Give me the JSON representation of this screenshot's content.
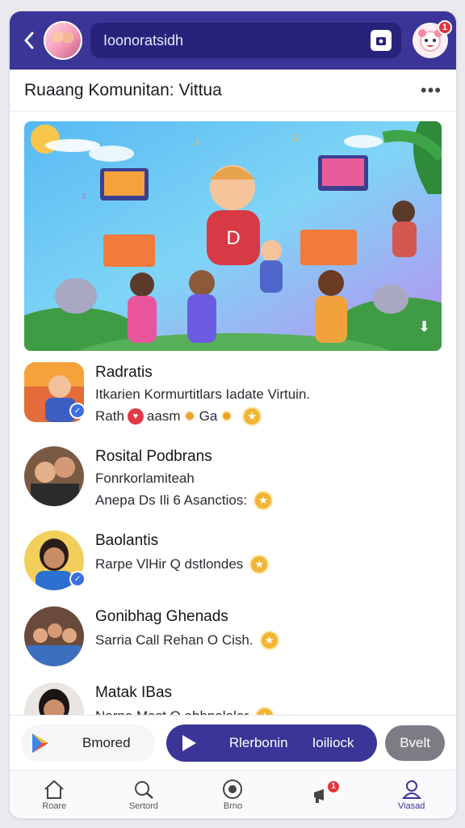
{
  "header": {
    "search_text": "Ioonoratsidh",
    "notification_count": "1"
  },
  "title_row": {
    "title": "Ruaang Komunitan: Vittua"
  },
  "hero": {
    "description_icon": "community-party-illustration"
  },
  "items": [
    {
      "name": "Radratis",
      "line1": "Itkarien Kormurtitlars Iadate Virtuin.",
      "line2": "Rath",
      "line2_b": "aasm",
      "line2_c": "Ga"
    },
    {
      "name": "Rosital Podbrans",
      "line1": "Fonrkorlamiteah",
      "line2": "Anepa Ds Ili 6 Asanctios:"
    },
    {
      "name": "Baolantis",
      "line1": "Rarpe VlHir Q dstlondes"
    },
    {
      "name": "Gonibhag Ghenads",
      "line1": "Sarria Call Rehan O Cish."
    },
    {
      "name": "Matak IBas",
      "line1": "Narne Mast O abhpalalar"
    }
  ],
  "action_bar": {
    "store_label": "Bmored",
    "radio_label": "Rlerbonin",
    "radio_label2": "Ioiliock",
    "small_button": "Bvelt"
  },
  "nav": {
    "home": "Roare",
    "search": "Sertord",
    "center": "Brno",
    "alerts_count": "1",
    "profile": "Viasad"
  },
  "colors": {
    "brand": "#3a3596",
    "badge": "#e3333a",
    "star": "#f1b537"
  }
}
